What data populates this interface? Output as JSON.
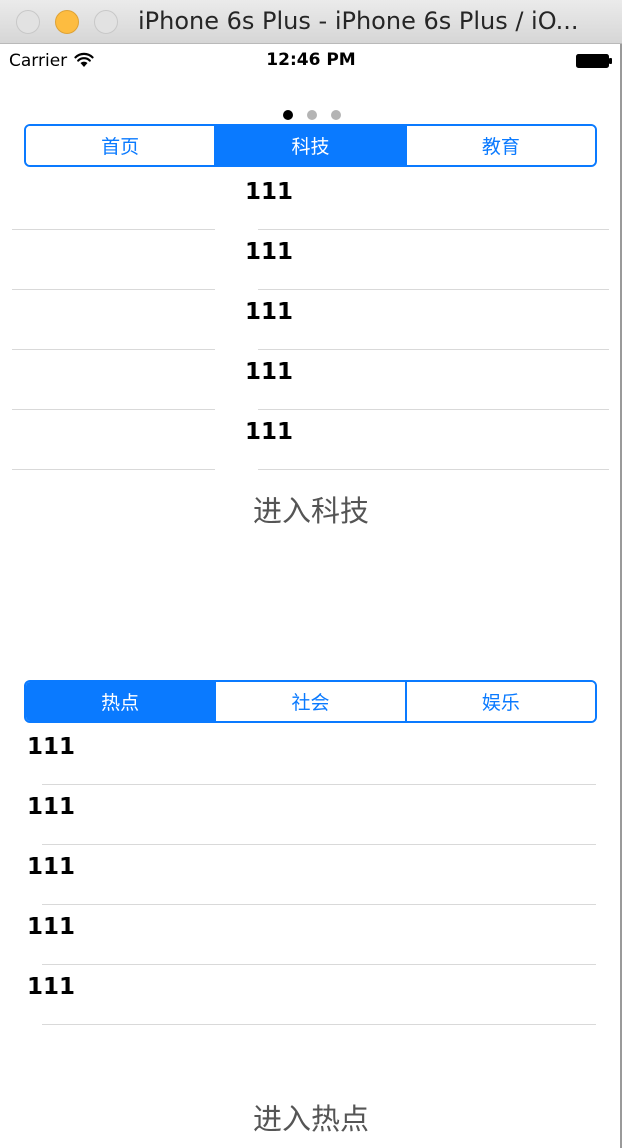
{
  "window": {
    "title": "iPhone 6s Plus - iPhone 6s Plus / iO..."
  },
  "status_bar": {
    "carrier": "Carrier",
    "time": "12:46 PM"
  },
  "page_control": {
    "page_count": 3,
    "current_page": 1
  },
  "top_section": {
    "segments": [
      "首页",
      "科技",
      "教育"
    ],
    "selected_segment": 2,
    "rows": [
      "111",
      "111",
      "111",
      "111",
      "111"
    ],
    "enter_label": "进入科技"
  },
  "bottom_section": {
    "segments": [
      "热点",
      "社会",
      "娱乐"
    ],
    "selected_segment": 1,
    "rows": [
      "111",
      "111",
      "111",
      "111",
      "111"
    ],
    "enter_label": "进入热点"
  },
  "colors": {
    "accent": "#0a7aff",
    "separator": "#d9d9d9",
    "label_gray": "#555555"
  }
}
